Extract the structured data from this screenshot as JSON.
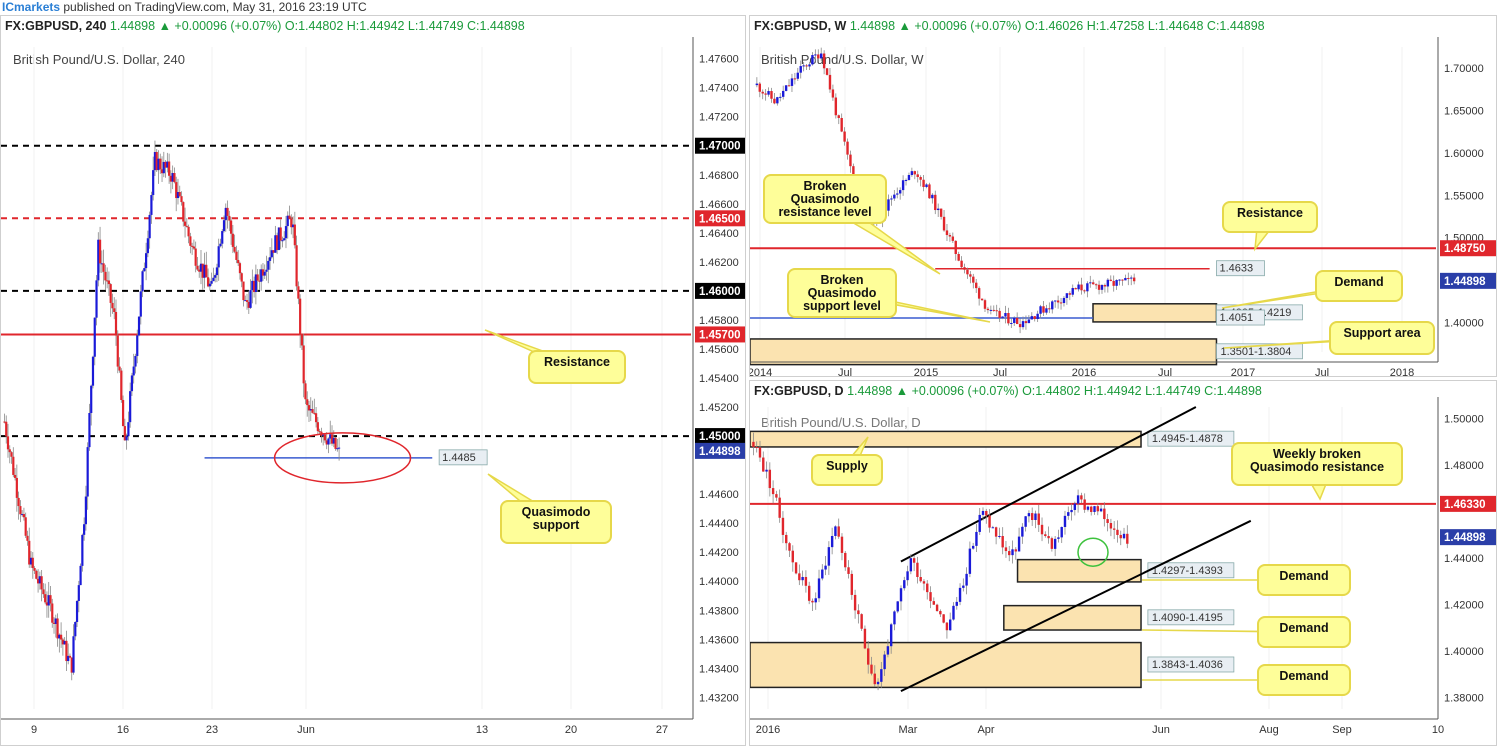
{
  "header": {
    "brand": "ICmarkets",
    "text": " published on TradingView.com, May 31, 2016 23:19 UTC"
  },
  "colors": {
    "up": "#1a1ad8",
    "down": "#e0262c",
    "annot_fill": "#fefe99",
    "annot_border": "#e6d84a",
    "zone_fill": "#fbe3b0"
  },
  "panels": {
    "h4": {
      "symbol": "FX:GBPUSD, 240",
      "quote": "1.44898 ▲ +0.00096 (+0.07%) O:1.44802 H:1.44942 L:1.44749 C:1.44898",
      "title": "British Pound/U.S. Dollar, 240"
    },
    "weekly": {
      "symbol": "FX:GBPUSD, W",
      "quote": "1.44898 ▲ +0.00096 (+0.07%) O:1.46026 H:1.47258 L:1.44648 C:1.44898",
      "title": "British Pound/U.S. Dollar, W"
    },
    "daily": {
      "symbol": "FX:GBPUSD, D",
      "quote": "1.44898 ▲ +0.00096 (+0.07%) O:1.44802 H:1.44942 L:1.44749 C:1.44898",
      "title": "British Pound/U.S. Dollar, D"
    }
  },
  "chart_data": [
    {
      "type": "candlestick",
      "title": "British Pound/U.S. Dollar, 240",
      "y_ticks": [
        "1.47600",
        "1.47400",
        "1.47200",
        "1.47000",
        "1.46800",
        "1.46600",
        "1.46500",
        "1.46400",
        "1.46200",
        "1.46000",
        "1.45800",
        "1.45700",
        "1.45600",
        "1.45400",
        "1.45200",
        "1.45000",
        "1.44898",
        "1.44600",
        "1.44400",
        "1.44200",
        "1.44000",
        "1.43800",
        "1.43600",
        "1.43400",
        "1.43200"
      ],
      "x_ticks": [
        "9",
        "16",
        "23",
        "Jun",
        "13",
        "20",
        "27"
      ],
      "ylim": [
        1.4312,
        1.4768
      ],
      "levels": [
        {
          "value": 1.47,
          "label": "1.47000",
          "style": "dashed-black"
        },
        {
          "value": 1.465,
          "label": "1.46500",
          "style": "dashed-red"
        },
        {
          "value": 1.46,
          "label": "1.46000",
          "style": "dashed-black"
        },
        {
          "value": 1.457,
          "label": "1.45700",
          "style": "solid-red"
        },
        {
          "value": 1.45,
          "label": "1.45000",
          "style": "dashed-black"
        },
        {
          "value": 1.4485,
          "label": "1.4485",
          "style": "blue-ray"
        }
      ],
      "last_price": "1.44898",
      "annotations": [
        "Resistance",
        "Quasimodo support"
      ]
    },
    {
      "type": "candlestick",
      "title": "British Pound/U.S. Dollar, W",
      "y_ticks": [
        "1.70000",
        "1.65000",
        "1.60000",
        "1.55000",
        "1.50000",
        "1.48750",
        "1.44898",
        "1.40000"
      ],
      "x_ticks": [
        "2014",
        "Jul",
        "2015",
        "Jul",
        "2016",
        "Jul",
        "2017",
        "Jul",
        "2018"
      ],
      "ylim": [
        1.365,
        1.725
      ],
      "levels": [
        {
          "value": 1.4875,
          "label": "1.48750",
          "style": "solid-red"
        },
        {
          "value": 1.4633,
          "label": "1.4633",
          "style": "red-ray"
        },
        {
          "value": 1.4051,
          "label": "1.4051",
          "style": "blue-line"
        }
      ],
      "zones": [
        {
          "label": "1.4005-1.4219",
          "low": 1.4005,
          "high": 1.4219
        },
        {
          "label": "1.3501-1.3804",
          "low": 1.3501,
          "high": 1.3804
        }
      ],
      "last_price": "1.44898",
      "annotations": [
        "Broken Quasimodo resistance level",
        "Resistance",
        "Broken Quasimodo support level",
        "Demand",
        "Support area"
      ]
    },
    {
      "type": "candlestick",
      "title": "British Pound/U.S. Dollar, D",
      "y_ticks": [
        "1.50000",
        "1.48000",
        "1.46330",
        "1.44898",
        "1.44000",
        "1.42000",
        "1.40000",
        "1.38000"
      ],
      "x_ticks": [
        "2016",
        "Mar",
        "Apr",
        "Jun",
        "Aug",
        "Sep",
        "10"
      ],
      "ylim": [
        1.375,
        1.505
      ],
      "levels": [
        {
          "value": 1.4633,
          "label": "1.46330",
          "style": "solid-red"
        }
      ],
      "zones": [
        {
          "label": "1.4945-1.4878",
          "low": 1.4878,
          "high": 1.4945
        },
        {
          "label": "1.4297-1.4393",
          "low": 1.4297,
          "high": 1.4393
        },
        {
          "label": "1.4090-1.4195",
          "low": 1.409,
          "high": 1.4195
        },
        {
          "label": "1.3843-1.4036",
          "low": 1.3843,
          "high": 1.4036
        }
      ],
      "last_price": "1.44898",
      "annotations": [
        "Supply",
        "Weekly broken Quasimodo resistance",
        "Demand",
        "Demand",
        "Demand"
      ]
    }
  ]
}
